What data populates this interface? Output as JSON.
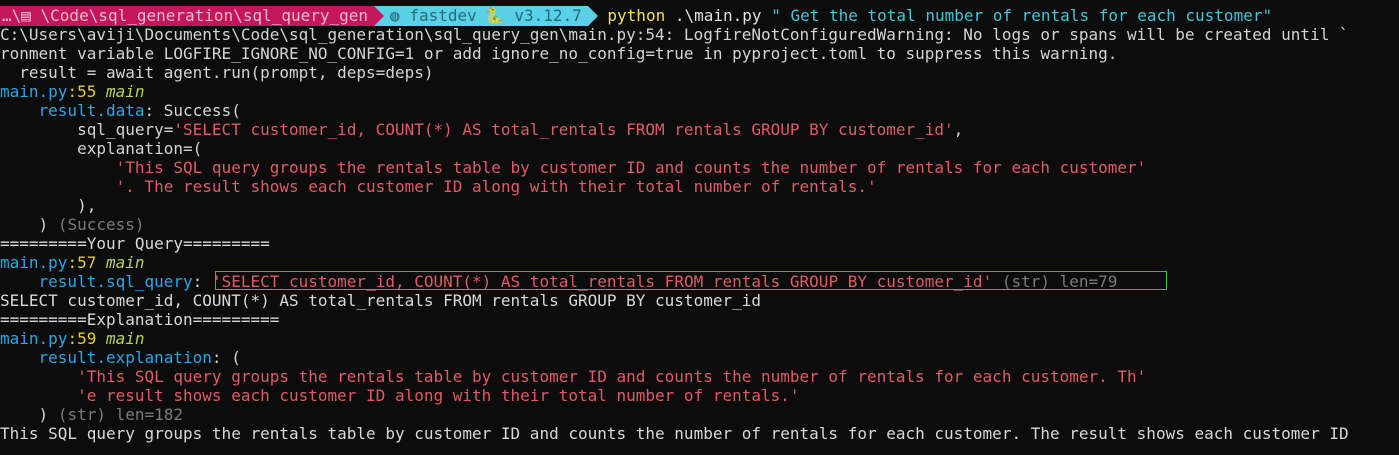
{
  "prompt": {
    "path_segment": "…\\▤ \\Code\\sql_generation\\sql_query_gen",
    "env_icon": "globe-icon",
    "env_name": "fastdev",
    "python_icon": "python-icon",
    "python_version": "v3.12.7",
    "command": "python",
    "command_arg": ".\\main.py",
    "command_string": "\" Get the total number of rentals for each customer\""
  },
  "warning": {
    "line1": "C:\\Users\\aviji\\Documents\\Code\\sql_generation\\sql_query_gen\\main.py:54: LogfireNotConfiguredWarning: No logs or spans will be created until `",
    "line2": "ronment variable LOGFIRE_IGNORE_NO_CONFIG=1 or add ignore_no_config=true in pyproject.toml to suppress this warning.",
    "line3": "  result = await agent.run(prompt, deps=deps)"
  },
  "block1": {
    "file": "main.py",
    "line": ":55",
    "func": "main",
    "attr": "result.data",
    "attr_suffix": ": Success(",
    "sql_key": "sql_query=",
    "sql_value": "'SELECT customer_id, COUNT(*) AS total_rentals FROM rentals GROUP BY customer_id'",
    "sql_comma": ",",
    "expl_key": "explanation=(",
    "expl_line1": "'This SQL query groups the rentals table by customer ID and counts the number of rentals for each customer'",
    "expl_line2": "'. The result shows each customer ID along with their total number of rentals.'",
    "close_paren": "),",
    "close_success": ")",
    "success_type": "(Success)"
  },
  "your_query_header": "=========Your Query=========",
  "block2": {
    "file": "main.py",
    "line": ":57",
    "func": "main",
    "attr": "result.sql_query",
    "colon": ":",
    "value": "'SELECT customer_id, COUNT(*) AS total_rentals FROM rentals GROUP BY customer_id'",
    "type_info": "(str) len=79"
  },
  "sql_output": "SELECT customer_id, COUNT(*) AS total_rentals FROM rentals GROUP BY customer_id",
  "explanation_header": "=========Explanation=========",
  "block3": {
    "file": "main.py",
    "line": ":59",
    "func": "main",
    "attr": "result.explanation",
    "attr_suffix": ": (",
    "line1": "'This SQL query groups the rentals table by customer ID and counts the number of rentals for each customer. Th'",
    "line2": "'e result shows each customer ID along with their total number of rentals.'",
    "close": ")",
    "type_info": "(str) len=182"
  },
  "final_output": "This SQL query groups the rentals table by customer ID and counts the number of rentals for each customer. The result shows each customer ID"
}
